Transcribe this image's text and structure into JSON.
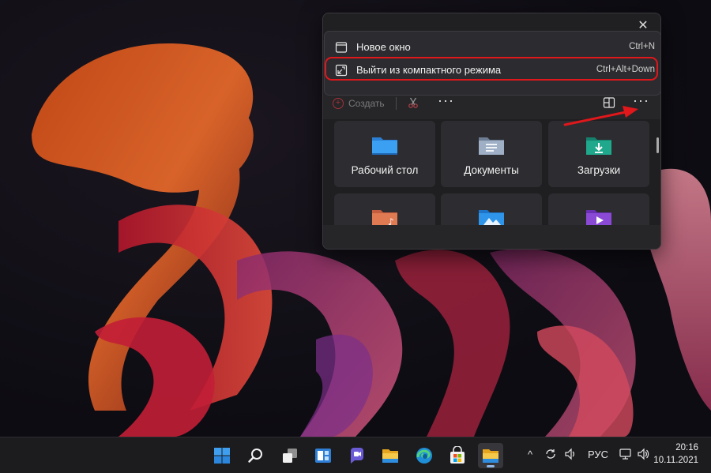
{
  "explorer": {
    "close_glyph": "✕",
    "context_menu": [
      {
        "label": "Новое окно",
        "shortcut": "Ctrl+N",
        "icon": "window-icon"
      },
      {
        "label": "Выйти из компактного режима",
        "shortcut": "Ctrl+Alt+Down",
        "icon": "exit-compact-icon"
      }
    ],
    "toolbar": {
      "create_label": "Создать",
      "more_glyph": "···"
    },
    "folders": [
      {
        "label": "Рабочий стол",
        "icon": "desktop-folder-icon"
      },
      {
        "label": "Документы",
        "icon": "documents-folder-icon"
      },
      {
        "label": "Загрузки",
        "icon": "downloads-folder-icon"
      },
      {
        "label": "",
        "icon": "music-folder-icon"
      },
      {
        "label": "",
        "icon": "pictures-folder-icon"
      },
      {
        "label": "",
        "icon": "videos-folder-icon"
      }
    ]
  },
  "taskbar": {
    "apps": [
      "start-icon",
      "search-icon",
      "task-view-icon",
      "widgets-icon",
      "chat-icon",
      "file-explorer-pinned-icon",
      "edge-icon",
      "store-icon",
      "file-explorer-active-icon"
    ],
    "tray": {
      "chevron": "^",
      "language": "РУС",
      "time": "20:16",
      "date": "10.11.2021"
    }
  },
  "colors": {
    "highlight": "#e0171b",
    "accent": "#8fb8e6"
  }
}
